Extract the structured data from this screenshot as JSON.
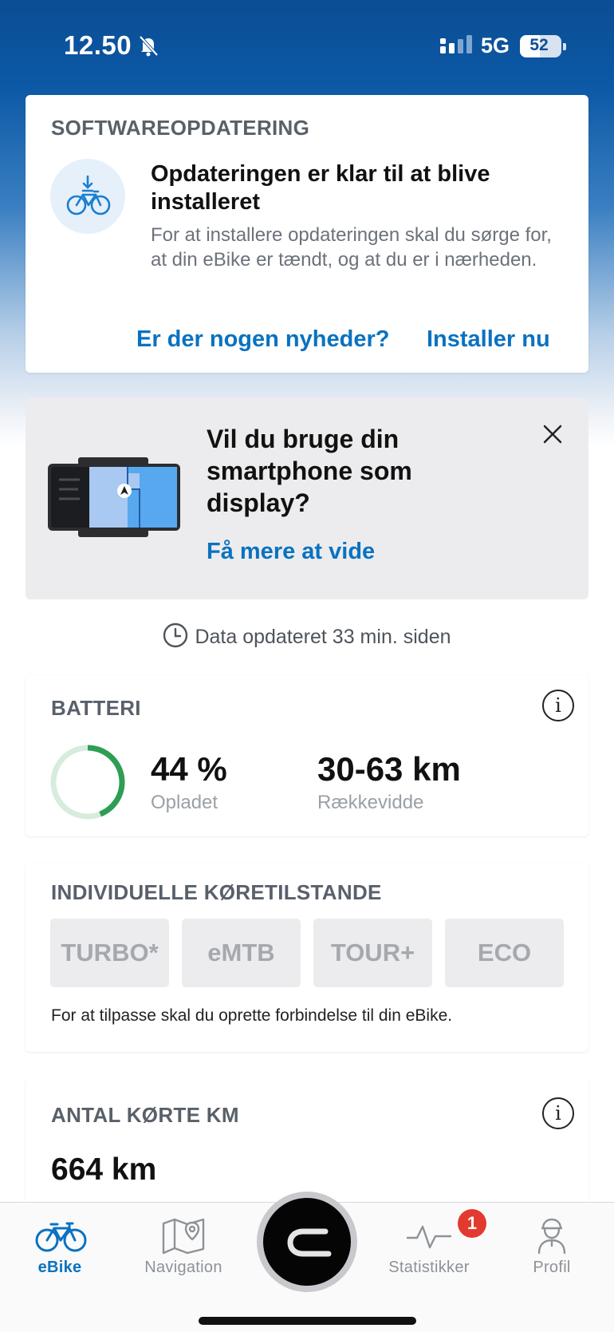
{
  "status_bar": {
    "time": "12.50",
    "network": "5G",
    "battery_percent": "52",
    "battery_level": 0.52
  },
  "software_update": {
    "section_title": "SOFTWAREOPDATERING",
    "heading": "Opdateringen er klar til at blive installeret",
    "body": "For at installere opdateringen skal du sørge for, at din eBike er tændt, og at du er i nærheden.",
    "news_link": "Er der nogen nyheder?",
    "install_link": "Installer nu",
    "icon": "bike-download-icon"
  },
  "promo": {
    "heading": "Vil du bruge din smartphone som display?",
    "link": "Få mere at vide",
    "close_icon": "close-icon"
  },
  "data_updated": "Data opdateret 33 min. siden",
  "battery": {
    "section_title": "BATTERI",
    "charge_value": "44 %",
    "charge_label": "Opladet",
    "charge_fraction": 0.44,
    "range_value": "30-63 km",
    "range_label": "Rækkevidde",
    "ring_color": "#2e9e55",
    "ring_track_color": "#d6ecdd"
  },
  "modes": {
    "section_title": "INDIVIDUELLE KØRETILSTANDE",
    "items": [
      "TURBO*",
      "eMTB",
      "TOUR+",
      "ECO"
    ],
    "note": "For at tilpasse skal du oprette forbindelse til din eBike."
  },
  "km": {
    "section_title": "ANTAL KØRTE KM",
    "value": "664 km"
  },
  "tabs": [
    {
      "label": "eBike",
      "icon": "bike-icon",
      "active": true
    },
    {
      "label": "Navigation",
      "icon": "map-icon",
      "active": false
    },
    {
      "label": "Statistikker",
      "icon": "activity-icon",
      "active": false,
      "badge": "1"
    },
    {
      "label": "Profil",
      "icon": "profile-icon",
      "active": false
    }
  ],
  "colors": {
    "header_blue": "#0a4d94",
    "link_blue": "#0a72c0",
    "badge_red": "#e23a2e"
  }
}
